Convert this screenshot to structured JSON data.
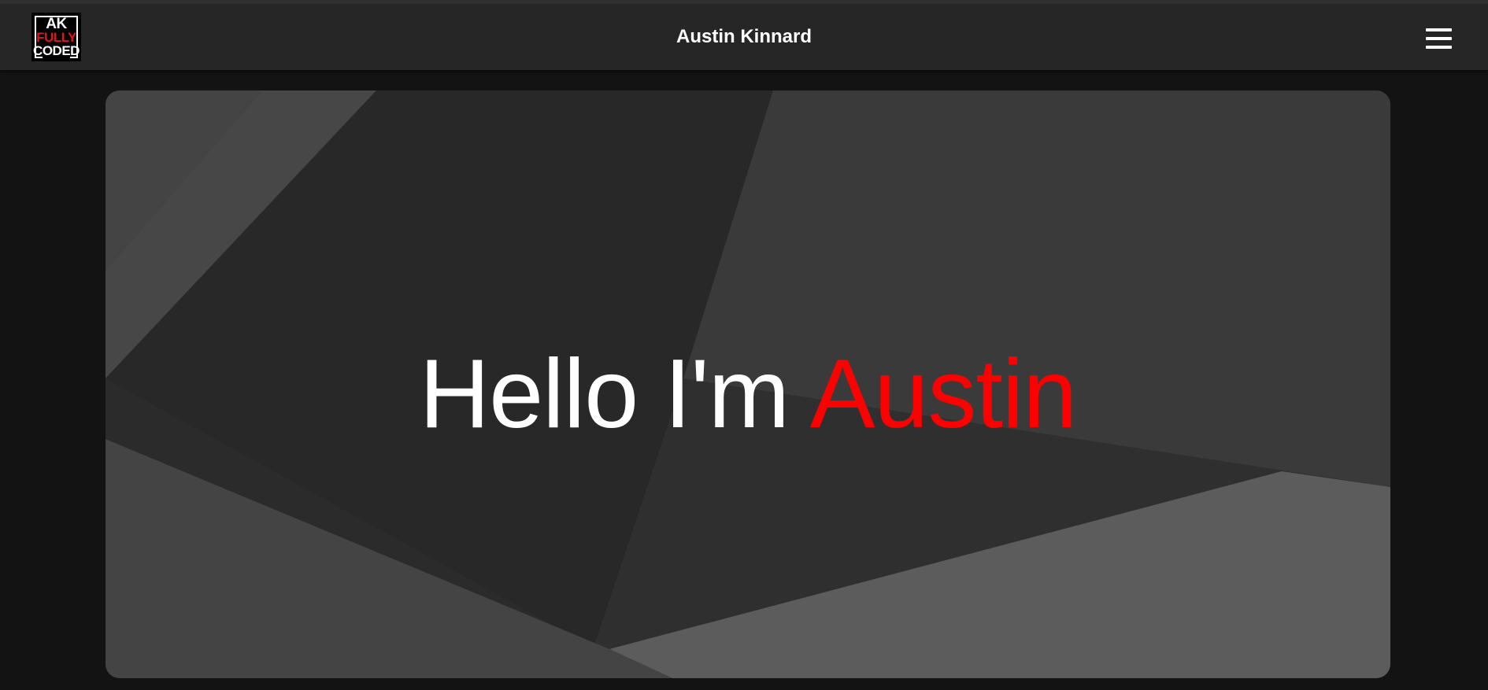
{
  "header": {
    "logo": {
      "line1": "AK",
      "line2": "FULLY",
      "line3": "CODED"
    },
    "title": "Austin Kinnard",
    "menu_icon": "hamburger-menu-icon"
  },
  "hero": {
    "greeting": "Hello I'm",
    "name": "Austin",
    "name_color": "#ff0000"
  },
  "colors": {
    "page_background": "#131313",
    "header_background": "#262626",
    "accent": "#ff0000",
    "logo_red": "#e3131b"
  }
}
